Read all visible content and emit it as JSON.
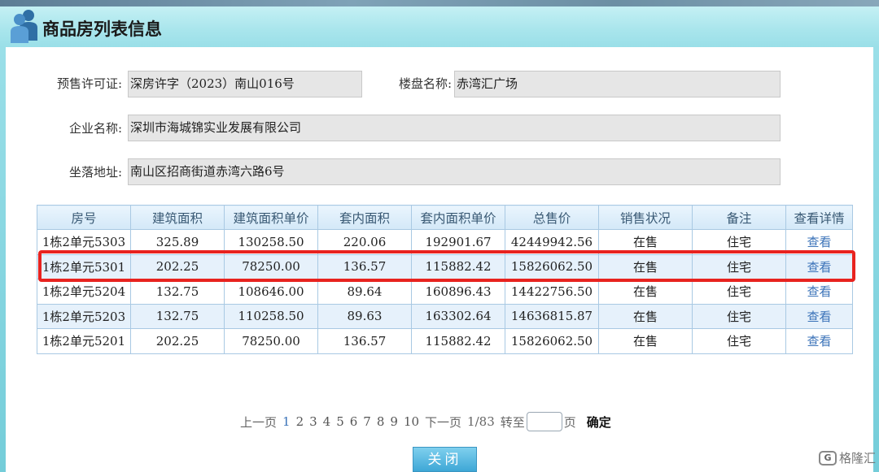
{
  "header": {
    "title": "商品房列表信息"
  },
  "form": {
    "permit_label": "预售许可证:",
    "permit_value": "深房许字（2023）南山016号",
    "project_label": "楼盘名称:",
    "project_value": "赤湾汇广场",
    "company_label": "企业名称:",
    "company_value": "深圳市海城锦实业发展有限公司",
    "address_label": "坐落地址:",
    "address_value": "南山区招商街道赤湾六路6号"
  },
  "table": {
    "headers": [
      "房号",
      "建筑面积",
      "建筑面积单价",
      "套内面积",
      "套内面积单价",
      "总售价",
      "销售状况",
      "备注",
      "查看详情"
    ],
    "rows": [
      [
        "1栋2单元5303",
        "325.89",
        "130258.50",
        "220.06",
        "192901.67",
        "42449942.56",
        "在售",
        "住宅",
        "查看"
      ],
      [
        "1栋2单元5301",
        "202.25",
        "78250.00",
        "136.57",
        "115882.42",
        "15826062.50",
        "在售",
        "住宅",
        "查看"
      ],
      [
        "1栋2单元5204",
        "132.75",
        "108646.00",
        "89.64",
        "160896.43",
        "14422756.50",
        "在售",
        "住宅",
        "查看"
      ],
      [
        "1栋2单元5203",
        "132.75",
        "110258.50",
        "89.63",
        "163302.64",
        "14636815.87",
        "在售",
        "住宅",
        "查看"
      ],
      [
        "1栋2单元5201",
        "202.25",
        "78250.00",
        "136.57",
        "115882.42",
        "15826062.50",
        "在售",
        "住宅",
        "查看"
      ]
    ]
  },
  "pager": {
    "prev": "上一页",
    "pages": [
      "1",
      "2",
      "3",
      "4",
      "5",
      "6",
      "7",
      "8",
      "9",
      "10"
    ],
    "current_page": "1",
    "next": "下一页",
    "page_info": "1/83",
    "goto_label": "转至",
    "goto_value": "",
    "page_unit": "页",
    "confirm": "确定"
  },
  "buttons": {
    "close": "关闭"
  },
  "watermark": {
    "logo": "G",
    "text": "格隆汇"
  },
  "colors": {
    "highlight": "#e8231f",
    "link": "#3a72b8",
    "header_bg": "#a8e5ec",
    "button": "#3ea7d6"
  }
}
